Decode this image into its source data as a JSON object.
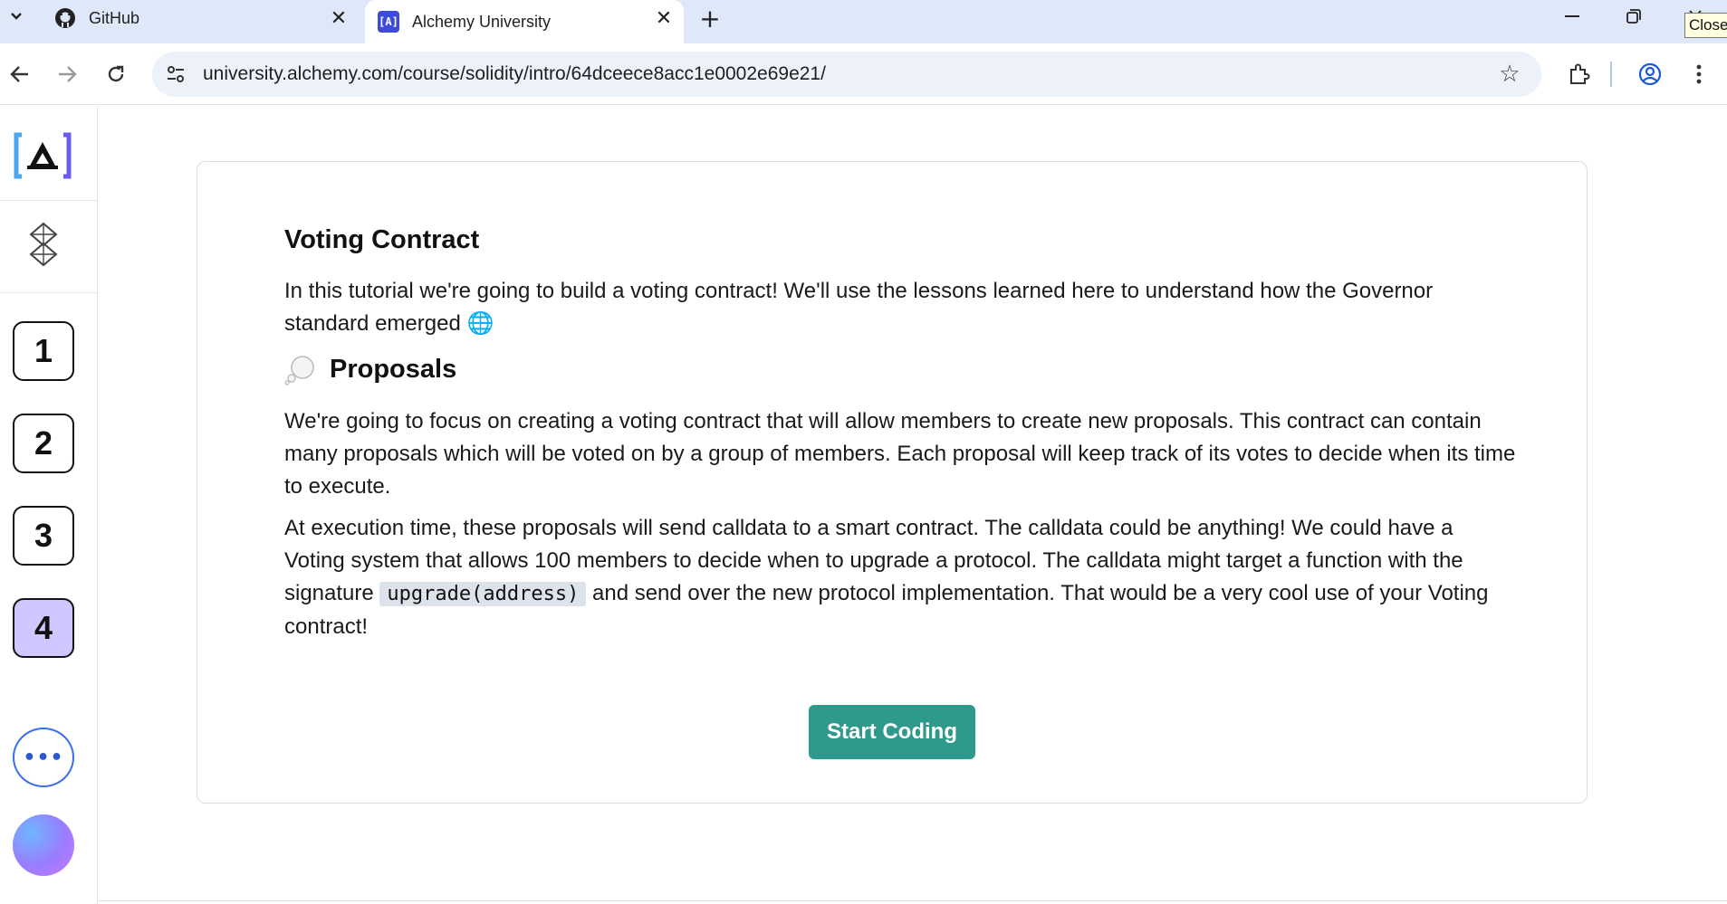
{
  "browser": {
    "tabs": [
      {
        "title": "GitHub",
        "icon": "github-icon"
      },
      {
        "title": "Alchemy University",
        "icon": "alchemy-icon",
        "favicon_text": "[A]"
      }
    ],
    "tooltip": "Close",
    "url": "university.alchemy.com/course/solidity/intro/64dceece8acc1e0002e69e21/"
  },
  "sidebar": {
    "steps": [
      "1",
      "2",
      "3",
      "4"
    ],
    "active_step": "4",
    "more_label": "•••"
  },
  "content": {
    "title": "Voting Contract",
    "intro": "In this tutorial we're going to build a voting contract! We'll use the lessons learned here to understand how the Governor standard emerged",
    "intro_emoji": "🌐",
    "section_title": "Proposals",
    "para1": "We're going to focus on creating a voting contract that will allow members to create new proposals. This contract can contain many proposals which will be voted on by a group of members. Each proposal will keep track of its votes to decide when its time to execute.",
    "para2_before": "At execution time, these proposals will send calldata to a smart contract. The calldata could be anything! We could have a Voting system that allows 100 members to decide when to upgrade a protocol. The calldata might target a function with the signature ",
    "para2_code": "upgrade(address)",
    "para2_after": " and send over the new protocol implementation. That would be a very cool use of your Voting contract!",
    "button": "Start Coding"
  },
  "colors": {
    "accent": "#2e9a8c",
    "active_step": "#cfc7ff",
    "tabstrip": "#dfe8f8"
  }
}
